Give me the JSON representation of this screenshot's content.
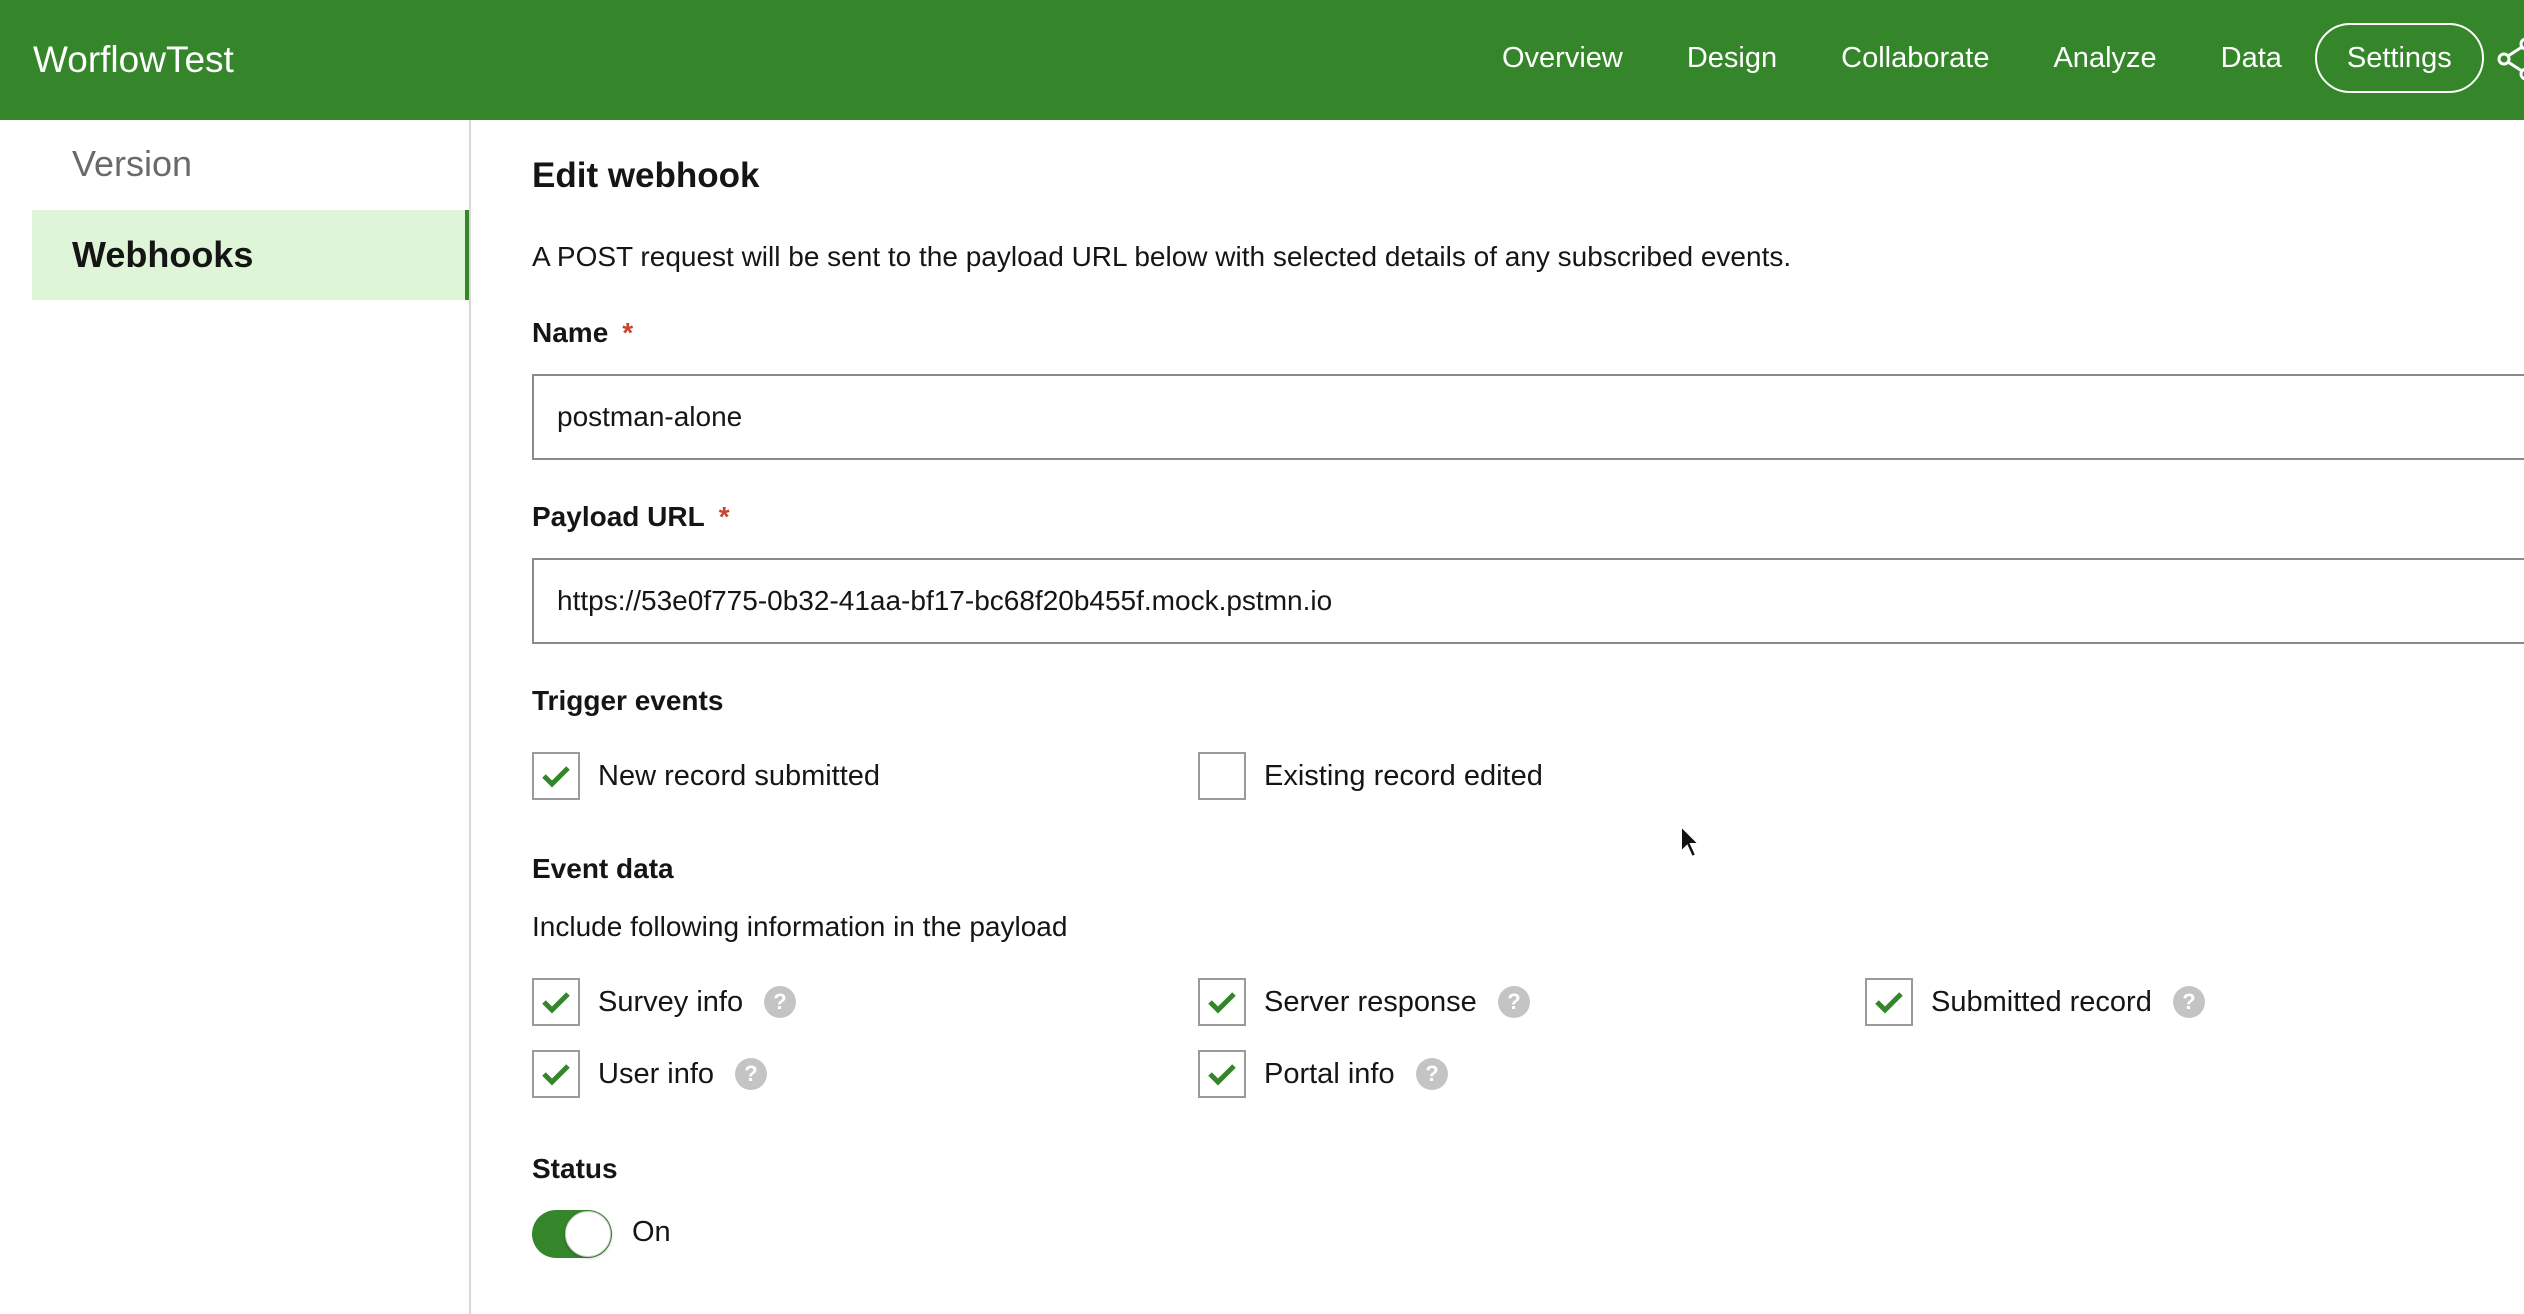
{
  "app": {
    "title": "WorflowTest"
  },
  "nav": {
    "items": [
      "Overview",
      "Design",
      "Collaborate",
      "Analyze",
      "Data",
      "Settings"
    ],
    "active": "Settings"
  },
  "sidebar": {
    "items": [
      {
        "label": "Version",
        "selected": false
      },
      {
        "label": "Webhooks",
        "selected": true
      }
    ]
  },
  "form": {
    "title": "Edit webhook",
    "description": "A POST request will be sent to the payload URL below with selected details of any subscribed events.",
    "name": {
      "label": "Name",
      "required_mark": "*",
      "value": "postman-alone"
    },
    "payload_url": {
      "label": "Payload URL",
      "required_mark": "*",
      "value": "https://53e0f775-0b32-41aa-bf17-bc68f20b455f.mock.pstmn.io"
    },
    "trigger_events": {
      "label": "Trigger events",
      "options": [
        {
          "label": "New record submitted",
          "checked": true
        },
        {
          "label": "Existing record edited",
          "checked": false
        }
      ]
    },
    "event_data": {
      "label": "Event data",
      "subtitle": "Include following information in the payload",
      "options": [
        {
          "label": "Survey info",
          "checked": true
        },
        {
          "label": "Server response",
          "checked": true
        },
        {
          "label": "Submitted record",
          "checked": true
        },
        {
          "label": "User info",
          "checked": true
        },
        {
          "label": "Portal info",
          "checked": true
        }
      ]
    },
    "status": {
      "label": "Status",
      "value": "On",
      "enabled": true
    }
  },
  "colors": {
    "brand_green": "#35862b",
    "selected_bg": "#dff5d7",
    "required_red": "#c8442c",
    "help_gray": "#c4c4c4"
  },
  "icons": {
    "share": "share-icon",
    "check": "check-icon",
    "help": "help-icon",
    "cursor": "mouse-cursor-icon"
  }
}
